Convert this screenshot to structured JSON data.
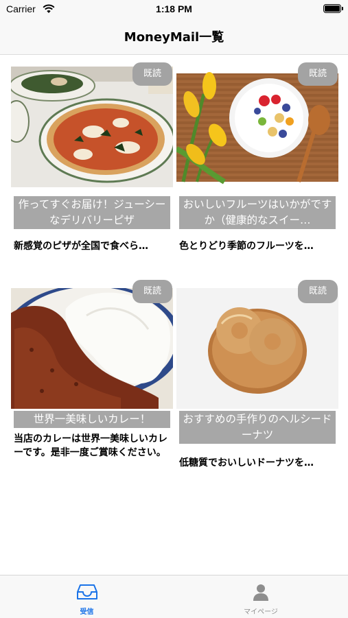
{
  "status": {
    "carrier": "Carrier",
    "time": "1:18 PM"
  },
  "nav": {
    "title": "MoneyMail一覧"
  },
  "cards": [
    {
      "badge": "既読",
      "headline": "作ってすぐお届け！ジューシーなデリバリーピザ",
      "body": "新感覚のピザが全国で食べら…",
      "image": "pizza-photo"
    },
    {
      "badge": "既読",
      "headline": "おいしいフルーツはいかがですか（健康的なスイー…",
      "body": "色とりどり季節のフルーツを…",
      "image": "fruit-yogurt-photo"
    },
    {
      "badge": "既読",
      "headline": "世界一美味しいカレー！",
      "body": "当店のカレーは世界一美味しいカレーです。是非一度ご賞味ください。",
      "image": "curry-photo"
    },
    {
      "badge": "既読",
      "headline": "おすすめの手作りのヘルシードーナツ",
      "body": "低糖質でおいしいドーナツを…",
      "image": "donut-photo"
    }
  ],
  "tabs": [
    {
      "label": "受信",
      "icon": "inbox-icon",
      "active": true
    },
    {
      "label": "マイページ",
      "icon": "person-icon",
      "active": false
    }
  ],
  "colors": {
    "accent": "#1a73e8",
    "badge": "#a3a3a3",
    "headline_bg": "#a7a7a7"
  }
}
